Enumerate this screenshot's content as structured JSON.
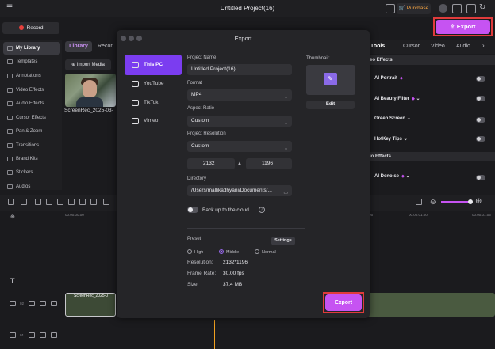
{
  "window": {
    "title": "Untitled Project(16)",
    "purchase_label": "Purchase"
  },
  "toolbar": {
    "record_label": "Record",
    "export_label": "Export"
  },
  "sidebar": {
    "items": [
      {
        "label": "My Library",
        "icon": "library-icon"
      },
      {
        "label": "Templates",
        "icon": "templates-icon"
      },
      {
        "label": "Annotations",
        "icon": "annotations-icon"
      },
      {
        "label": "Video Effects",
        "icon": "video-effects-icon"
      },
      {
        "label": "Audio Effects",
        "icon": "audio-effects-icon"
      },
      {
        "label": "Cursor Effects",
        "icon": "cursor-effects-icon"
      },
      {
        "label": "Pan & Zoom",
        "icon": "pan-zoom-icon"
      },
      {
        "label": "Transitions",
        "icon": "transitions-icon"
      },
      {
        "label": "Brand Kits",
        "icon": "brand-kits-icon"
      },
      {
        "label": "Stickers",
        "icon": "stickers-icon"
      },
      {
        "label": "Audios",
        "icon": "audios-icon"
      }
    ]
  },
  "library": {
    "tab_label": "Library",
    "record_tab": "Recor",
    "import_label": "Import Media",
    "media_name": "ScreenRec_2025-03-"
  },
  "right_panel": {
    "tabs": [
      "gic Tools",
      "Cursor",
      "Video",
      "Audio"
    ],
    "section_video": "eo Effects",
    "section_audio": "io Effects",
    "rows": [
      "AI Portrait",
      "AI Beauty Filter",
      "Green Screen",
      "HotKey Tips",
      "AI Denoise"
    ]
  },
  "timeline": {
    "ruler": [
      "00:00:00:00",
      "00:00:00:05",
      "00:00:01:00",
      "00:00:01:05"
    ],
    "clip_label": "ScreenRec_2025-0",
    "track_labels": [
      "02",
      "01"
    ]
  },
  "modal": {
    "title": "Export",
    "destinations": [
      "This PC",
      "YouTube",
      "TikTok",
      "Vimeo"
    ],
    "project_name_label": "Project Name",
    "project_name_value": "Untitled Project(16)",
    "format_label": "Format",
    "format_value": "MP4",
    "aspect_label": "Aspect Ratio",
    "aspect_value": "Custom",
    "resolution_label": "Project Resolution",
    "resolution_value": "Custom",
    "width_value": "2132",
    "height_value": "1196",
    "directory_label": "Directory",
    "directory_value": "/Users/mallikadhyani/Documents/...",
    "cloud_label": "Back up to the cloud",
    "thumbnail_label": "Thumbnail:",
    "edit_label": "Edit",
    "preset_label": "Preset",
    "settings_label": "Settings",
    "presets": [
      "High",
      "Middle",
      "Normal"
    ],
    "selected_preset": "Middle",
    "info": [
      {
        "key": "Resolution:",
        "value": "2132*1196"
      },
      {
        "key": "Frame Rate:",
        "value": "30.00 fps"
      },
      {
        "key": "Size:",
        "value": "37.4 MB"
      }
    ],
    "export_label": "Export"
  },
  "colors": {
    "accent": "#c653f2",
    "highlight": "#e03b3b",
    "active_dest": "#7b3df0"
  }
}
